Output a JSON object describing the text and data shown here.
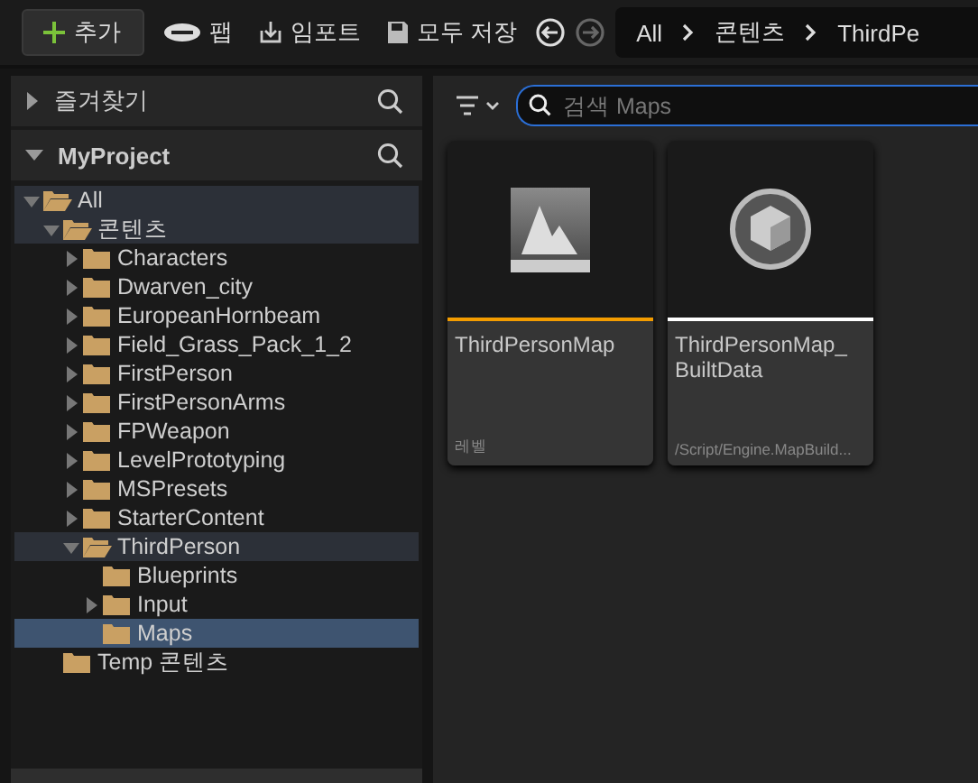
{
  "toolbar": {
    "add_button": "추가",
    "fab_button": "팹",
    "import_button": "임포트",
    "save_all_button": "모두 저장",
    "back_enabled": true,
    "forward_enabled": false,
    "breadcrumb": [
      "All",
      "콘텐츠",
      "ThirdPe"
    ]
  },
  "favorites": {
    "title": "즐겨찾기",
    "expanded": false
  },
  "project": {
    "title": "MyProject",
    "expanded": true
  },
  "tree": [
    {
      "label": "All",
      "expandable": true,
      "expanded": true,
      "selected": false,
      "children": [
        {
          "label": "콘텐츠",
          "expandable": true,
          "expanded": true,
          "selected": false,
          "children": [
            {
              "label": "Characters",
              "expandable": true,
              "expanded": false,
              "selected": false
            },
            {
              "label": "Dwarven_city",
              "expandable": true,
              "expanded": false,
              "selected": false
            },
            {
              "label": "EuropeanHornbeam",
              "expandable": true,
              "expanded": false,
              "selected": false
            },
            {
              "label": "Field_Grass_Pack_1_2",
              "expandable": true,
              "expanded": false,
              "selected": false
            },
            {
              "label": "FirstPerson",
              "expandable": true,
              "expanded": false,
              "selected": false
            },
            {
              "label": "FirstPersonArms",
              "expandable": true,
              "expanded": false,
              "selected": false
            },
            {
              "label": "FPWeapon",
              "expandable": true,
              "expanded": false,
              "selected": false
            },
            {
              "label": "LevelPrototyping",
              "expandable": true,
              "expanded": false,
              "selected": false
            },
            {
              "label": "MSPresets",
              "expandable": true,
              "expanded": false,
              "selected": false
            },
            {
              "label": "StarterContent",
              "expandable": true,
              "expanded": false,
              "selected": false
            },
            {
              "label": "ThirdPerson",
              "expandable": true,
              "expanded": true,
              "selected": false,
              "children": [
                {
                  "label": "Blueprints",
                  "expandable": false,
                  "expanded": false,
                  "selected": false
                },
                {
                  "label": "Input",
                  "expandable": true,
                  "expanded": false,
                  "selected": false
                },
                {
                  "label": "Maps",
                  "expandable": false,
                  "expanded": false,
                  "selected": true
                }
              ]
            }
          ]
        },
        {
          "label": "Temp 콘텐츠",
          "expandable": false,
          "expanded": false,
          "selected": false
        }
      ]
    }
  ],
  "search": {
    "placeholder": "검색 Maps"
  },
  "assets": [
    {
      "kind": "map",
      "name": "ThirdPersonMap",
      "type": "레벨",
      "color": "#f39c00"
    },
    {
      "kind": "builtdata",
      "name": "ThirdPersonMap_ BuiltData",
      "type": "/Script/Engine.MapBuild...",
      "color": "#ffffff"
    }
  ]
}
